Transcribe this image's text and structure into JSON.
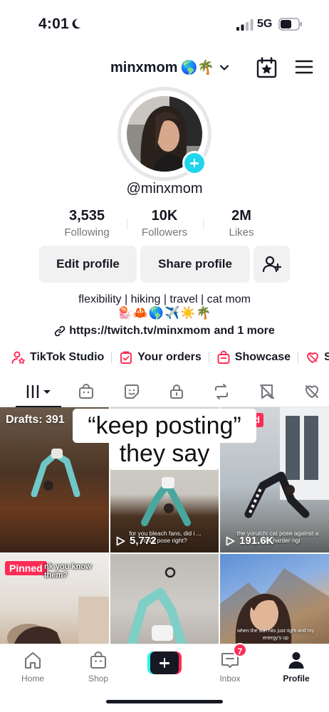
{
  "status_bar": {
    "time": "4:01",
    "network": "5G"
  },
  "header": {
    "username": "minxmom",
    "username_emoji": "🌎🌴"
  },
  "profile": {
    "handle": "@minxmom",
    "stats": [
      {
        "value": "3,535",
        "label": "Following"
      },
      {
        "value": "10K",
        "label": "Followers"
      },
      {
        "value": "2M",
        "label": "Likes"
      }
    ],
    "buttons": {
      "edit": "Edit profile",
      "share": "Share profile"
    },
    "bio_line1": "flexibility | hiking | travel | cat mom",
    "bio_emojis": "🪼🦀🌎✈️☀️🌴",
    "link": "https://twitch.tv/minxmom",
    "link_more": "and 1 more"
  },
  "shortcuts": [
    {
      "label": "TikTok Studio"
    },
    {
      "label": "Your orders"
    },
    {
      "label": "Showcase"
    },
    {
      "label": "Su"
    }
  ],
  "grid": {
    "drafts_label": "Drafts: 391",
    "pinned_label": "Pinned",
    "red_tag_text": "d",
    "videos": [
      {
        "views": "5,772",
        "caption": "for you bleach fans, did i ... chi's pose right?"
      },
      {
        "views": "191.6K",
        "caption": "the yoruichi cat pose against a ... ally harder ngl"
      }
    ],
    "cell4_caption": "nk you know them?",
    "cell6_caption": "when the sun hits just right and my energy's up"
  },
  "overlay_caption": {
    "line1": "“keep posting”",
    "line2": "they say"
  },
  "bottom_nav": {
    "items": [
      {
        "label": "Home"
      },
      {
        "label": "Shop"
      },
      {
        "label": "Inbox"
      },
      {
        "label": "Profile"
      }
    ],
    "inbox_badge": "7"
  },
  "colors": {
    "accent": "#fe2c55",
    "cyan": "#20d5ec",
    "text": "#161823",
    "muted": "#75767c"
  }
}
